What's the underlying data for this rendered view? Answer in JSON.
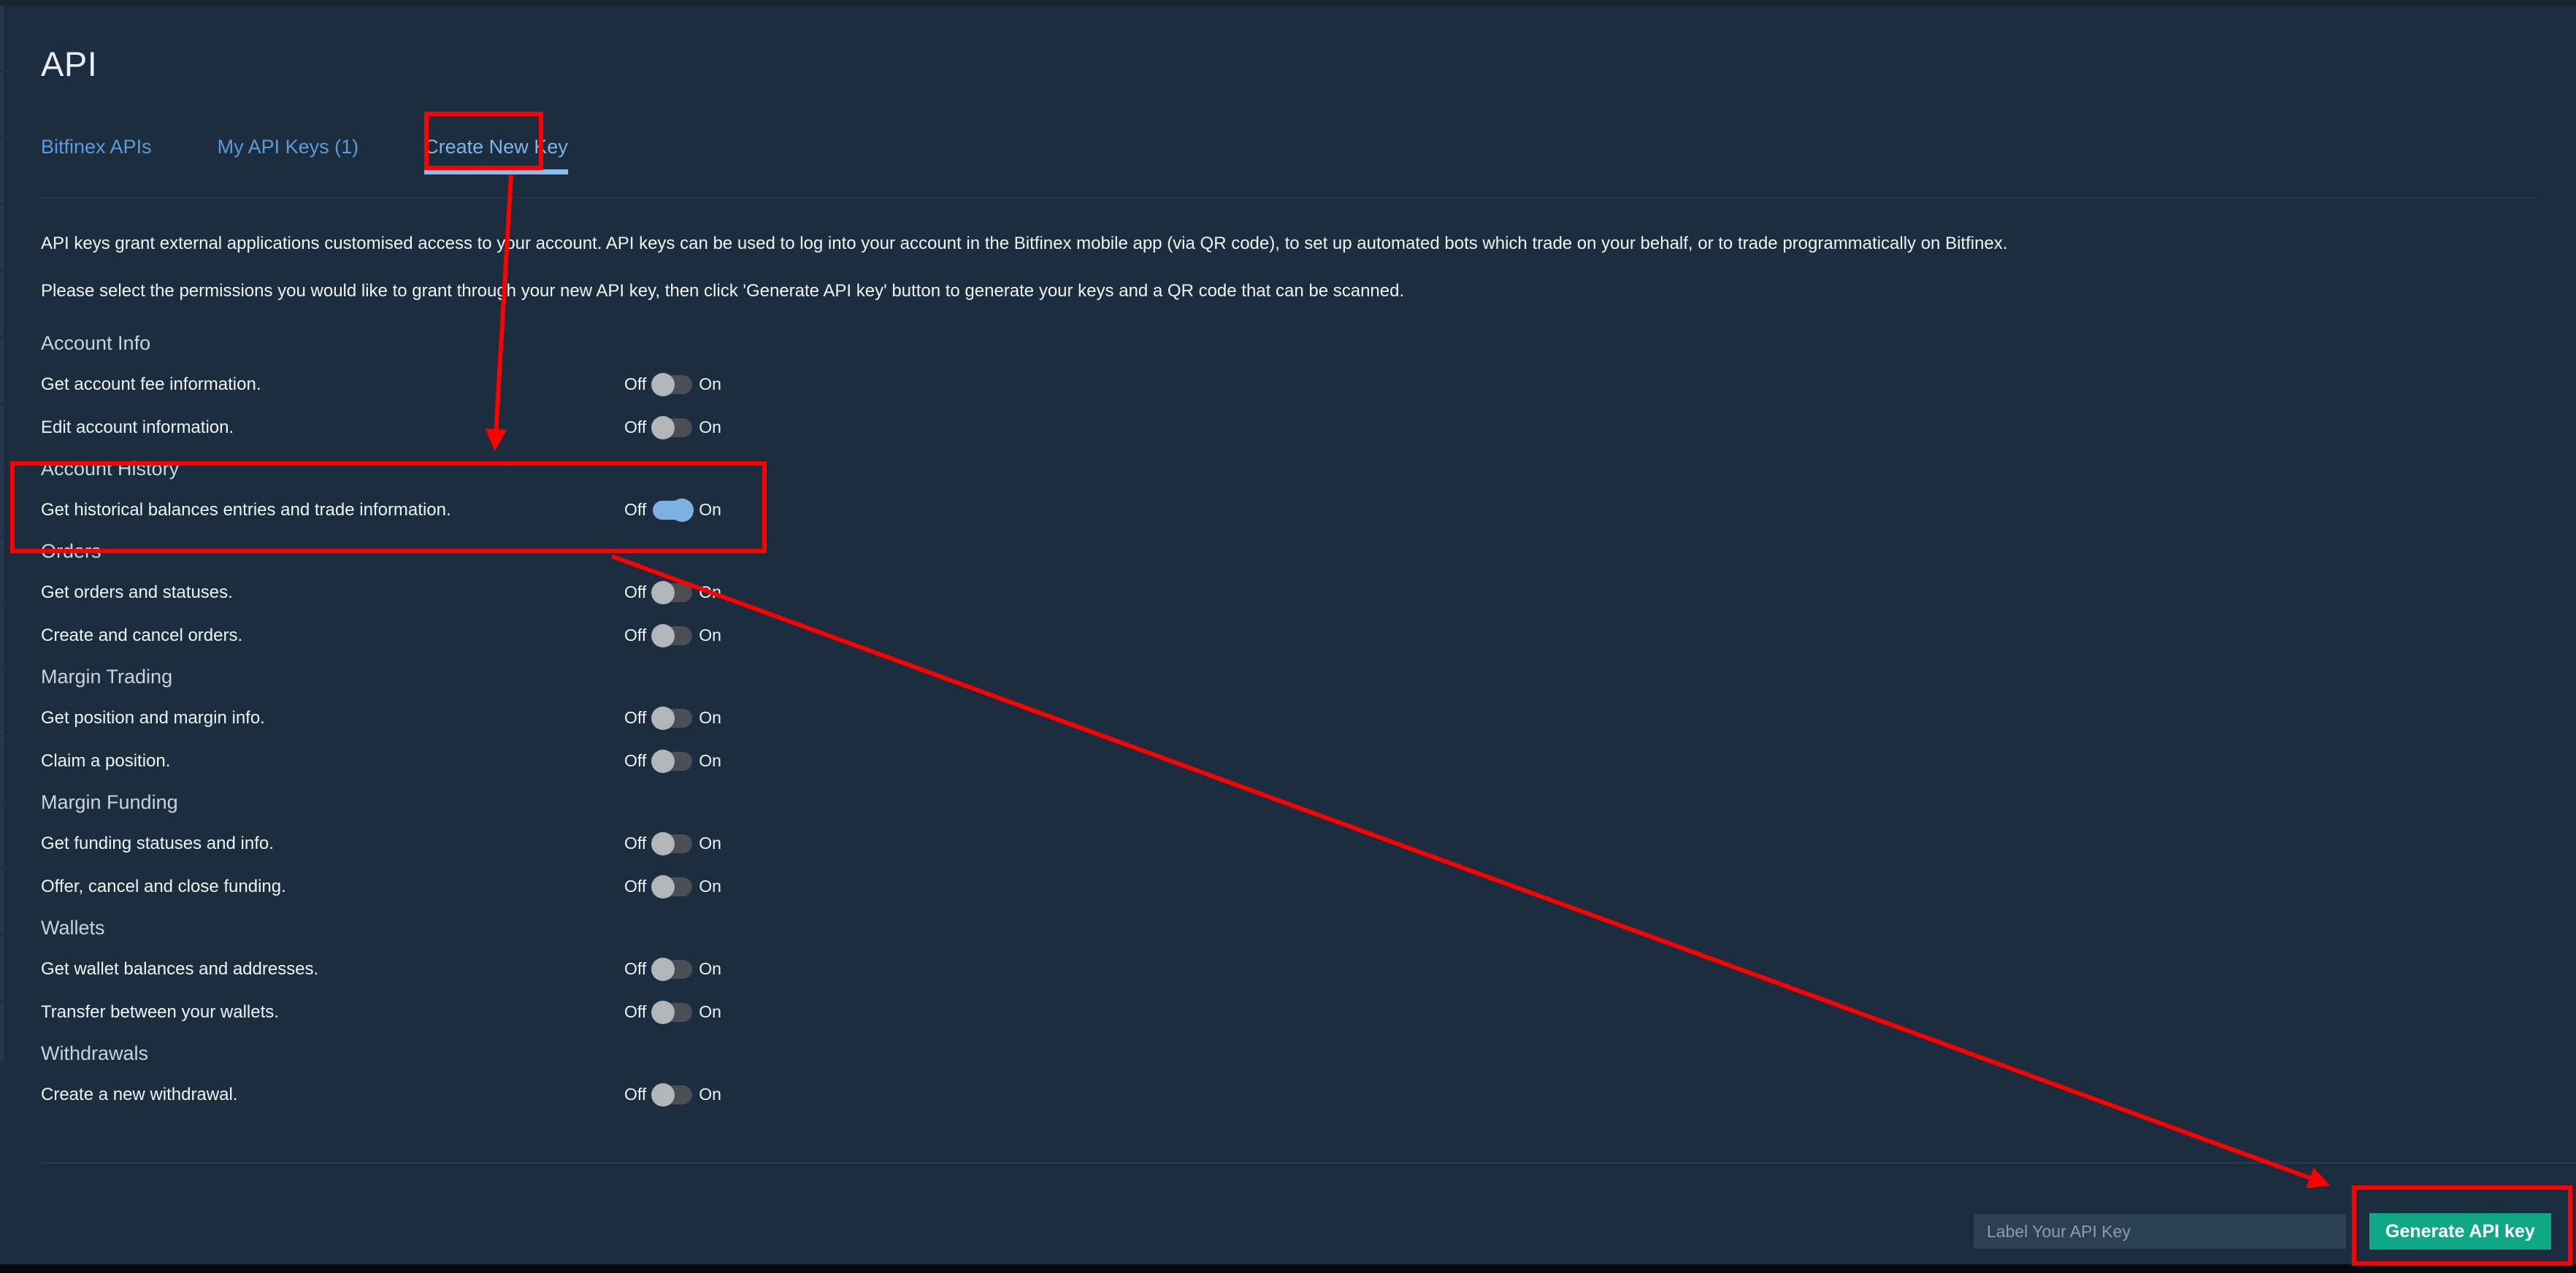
{
  "page": {
    "title": "API"
  },
  "tabs": [
    {
      "label": "Bitfinex APIs",
      "active": false
    },
    {
      "label": "My API Keys (1)",
      "active": false
    },
    {
      "label": "Create New Key",
      "active": true
    }
  ],
  "intro": {
    "line1": "API keys grant external applications customised access to your account. API keys can be used to log into your account in the Bitfinex mobile app (via QR code), to set up automated bots which trade on your behalf, or to trade programmatically on Bitfinex.",
    "line2": "Please select the permissions you would like to grant through your new API key, then click 'Generate API key' button to generate your keys and a QR code that can be scanned."
  },
  "toggle_labels": {
    "off": "Off",
    "on": "On"
  },
  "sections": [
    {
      "title": "Account Info",
      "rows": [
        {
          "label": "Get account fee information.",
          "state": "off"
        },
        {
          "label": "Edit account information.",
          "state": "off"
        }
      ]
    },
    {
      "title": "Account History",
      "rows": [
        {
          "label": "Get historical balances entries and trade information.",
          "state": "on"
        }
      ]
    },
    {
      "title": "Orders",
      "rows": [
        {
          "label": "Get orders and statuses.",
          "state": "off"
        },
        {
          "label": "Create and cancel orders.",
          "state": "off"
        }
      ]
    },
    {
      "title": "Margin Trading",
      "rows": [
        {
          "label": "Get position and margin info.",
          "state": "off"
        },
        {
          "label": "Claim a position.",
          "state": "off"
        }
      ]
    },
    {
      "title": "Margin Funding",
      "rows": [
        {
          "label": "Get funding statuses and info.",
          "state": "off"
        },
        {
          "label": "Offer, cancel and close funding.",
          "state": "off"
        }
      ]
    },
    {
      "title": "Wallets",
      "rows": [
        {
          "label": "Get wallet balances and addresses.",
          "state": "off"
        },
        {
          "label": "Transfer between your wallets.",
          "state": "off"
        }
      ]
    },
    {
      "title": "Withdrawals",
      "rows": [
        {
          "label": "Create a new withdrawal.",
          "state": "off"
        }
      ]
    }
  ],
  "footer": {
    "label_input_value": "",
    "label_input_placeholder": "Label Your API Key",
    "generate_button": "Generate API key"
  },
  "colors": {
    "background": "#1b2d3e",
    "tab_link": "#5a9bd8",
    "tab_active_underline": "#8cbcec",
    "toggle_on": "#7fb0e4",
    "toggle_off_track": "#4a4f55",
    "toggle_off_knob": "#b3b6b8",
    "generate_button": "#10a884",
    "input_background": "#2b4055",
    "annotation": "#ff0000"
  }
}
